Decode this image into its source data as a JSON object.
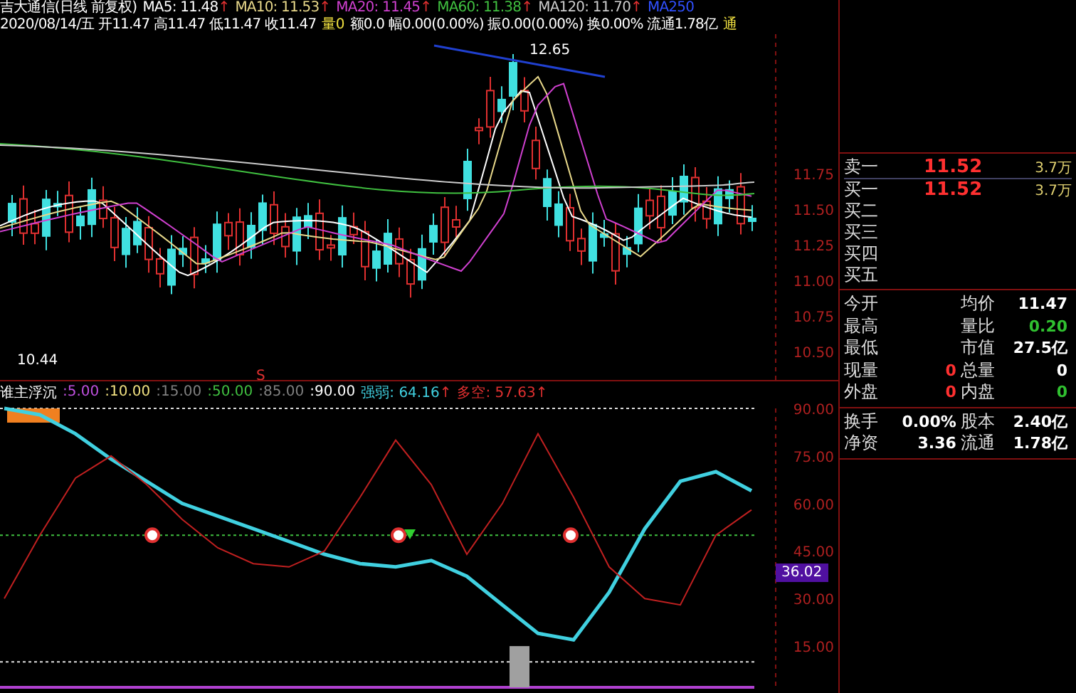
{
  "title_line": {
    "name": "吉大通信(日线 前复权)",
    "ma": [
      {
        "label": "MA5: 11.48",
        "arrow": "↑",
        "color": "#ffffff"
      },
      {
        "label": "MA10: 11.53",
        "arrow": "↑",
        "color": "#e8d88a"
      },
      {
        "label": "MA20: 11.45",
        "arrow": "↑",
        "color": "#d040d0"
      },
      {
        "label": "MA60: 11.38",
        "arrow": "↑",
        "color": "#40c040"
      },
      {
        "label": "MA120: 11.70",
        "arrow": "↑",
        "color": "#cccccc"
      },
      {
        "label": "MA250",
        "color": "#3050ff"
      }
    ]
  },
  "quote_line": [
    {
      "text": "2020/08/14/五 开11.47 高11.47 低11.47 收11.47",
      "color": "#ffffff"
    },
    {
      "text": "量0",
      "color": "#f0e040"
    },
    {
      "text": "额0.0 幅0.00(0.00%) 振0.00(0.00%) 换0.00% 流通1.78亿",
      "color": "#ffffff"
    },
    {
      "text": "通",
      "color": "#f0e040"
    }
  ],
  "price_chart": {
    "high_label": "12.65",
    "low_label": "10.44",
    "signal": "S",
    "yticks": [
      "11.75",
      "11.50",
      "11.25",
      "11.00",
      "10.75",
      "10.50"
    ]
  },
  "indicator": {
    "name": "谁主浮沉",
    "params": [
      {
        "text": ":5.00",
        "color": "#c050e0"
      },
      {
        "text": ":10.00",
        "color": "#f0e080"
      },
      {
        "text": ":15.00",
        "color": "#808080"
      },
      {
        "text": ":50.00",
        "color": "#40c040"
      },
      {
        "text": ":85.00",
        "color": "#808080"
      },
      {
        "text": ":90.00",
        "color": "#ffffff"
      }
    ],
    "readings": [
      {
        "text": ": 64.16",
        "arrow": "↑",
        "color": "#40d0e0"
      },
      {
        "text": ": 57.63",
        "arrow": "↑",
        "color": "#e03030"
      }
    ],
    "current_tag": "36.02",
    "chart_data": {
      "type": "line",
      "ylim": [
        2,
        90
      ],
      "yticks": [
        {
          "value": 15,
          "label": "15.00"
        },
        {
          "value": 30,
          "label": "30.00"
        },
        {
          "value": 45,
          "label": "45.00"
        },
        {
          "value": 60,
          "label": "60.00"
        },
        {
          "value": 75,
          "label": "75.00"
        },
        {
          "value": 90,
          "label": "90.00"
        }
      ],
      "series": [
        {
          "name": "强弱",
          "color": "#40d0e0",
          "values": [
            90,
            88,
            82,
            74,
            67,
            60,
            56,
            52,
            48,
            44,
            41,
            40,
            42,
            37,
            28,
            19,
            17,
            32,
            52,
            67,
            70,
            64
          ]
        },
        {
          "name": "多空",
          "color": "#c02020",
          "values": [
            30,
            50,
            68,
            75,
            66,
            55,
            46,
            41,
            40,
            45,
            62,
            80,
            66,
            44,
            60,
            82,
            62,
            40,
            30,
            28,
            50,
            58
          ]
        }
      ]
    }
  },
  "order_book": [
    {
      "label": "卖一",
      "price": "11.52",
      "volume": "3.7万"
    },
    {
      "label": "买一",
      "price": "11.52",
      "volume": "3.7万"
    },
    {
      "label": "买二"
    },
    {
      "label": "买三"
    },
    {
      "label": "买四"
    },
    {
      "label": "买五"
    }
  ],
  "stats": [
    [
      {
        "label": "今开"
      },
      {
        "label": "均价",
        "value": "11.47",
        "color": "#ffffff"
      }
    ],
    [
      {
        "label": "最高"
      },
      {
        "label": "量比",
        "value": "0.20",
        "color": "#30c030"
      }
    ],
    [
      {
        "label": "最低"
      },
      {
        "label": "市值",
        "value": "27.5亿",
        "color": "#ffffff"
      }
    ],
    [
      {
        "label": "现量",
        "value": "0",
        "color": "#ff3030"
      },
      {
        "label": "总量",
        "value": "0",
        "color": "#ffffff"
      }
    ],
    [
      {
        "label": "外盘",
        "value": "0",
        "color": "#ff3030"
      },
      {
        "label": "内盘",
        "value": "0",
        "color": "#30c030"
      }
    ]
  ],
  "capital": [
    [
      {
        "label": "换手",
        "value": "0.00%"
      },
      {
        "label": "股本",
        "value": "2.40亿"
      }
    ],
    [
      {
        "label": "净资",
        "value": "3.36"
      },
      {
        "label": "流通",
        "value": "1.78亿"
      }
    ]
  ]
}
